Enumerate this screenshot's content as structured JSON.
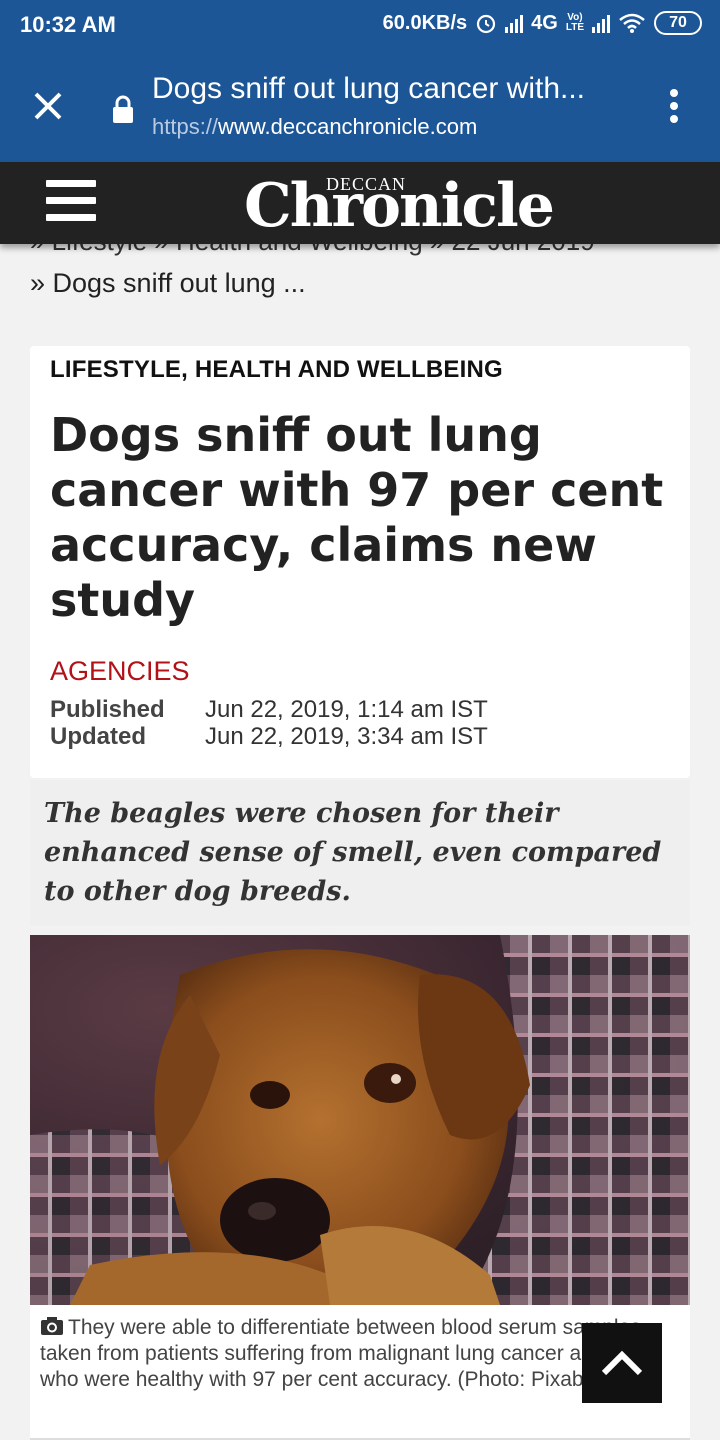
{
  "status_bar": {
    "time": "10:32 AM",
    "speed": "60.0KB/s",
    "network": "4G",
    "volte": "Vo) LTE",
    "battery": "70"
  },
  "browser": {
    "title": "Dogs sniff out lung cancer with...",
    "url_scheme": "https://",
    "url_host": "www.deccanchronicle.com",
    "icons": [
      "close-icon",
      "lock-icon",
      "more-vert-icon"
    ]
  },
  "site": {
    "logo_top": "DECCAN",
    "logo_main": "Chronicle"
  },
  "breadcrumb": {
    "hidden_trail": "» Lifestyle » Health and Wellbeing » 22 Jun 2019",
    "current": "» Dogs sniff out lung ..."
  },
  "article": {
    "section": "LIFESTYLE, HEALTH AND WELLBEING",
    "headline": "Dogs sniff out lung cancer with 97 per cent accuracy, claims new study",
    "author": "AGENCIES",
    "published_label": "Published",
    "published_value": "Jun 22, 2019, 1:14 am IST",
    "updated_label": "Updated",
    "updated_value": "Jun 22, 2019, 3:34 am IST",
    "summary": "The beagles were chosen for their enhanced sense of smell, even compared to other dog breeds.",
    "caption": "They were able to differentiate between blood serum samples taken from patients suffering from malignant lung cancer and those who were healthy with 97 per cent accuracy. (Photo: Pixabay)"
  },
  "colors": {
    "browser_blue": "#1d5696",
    "header_dark": "#222222",
    "author_red": "#b01217"
  }
}
